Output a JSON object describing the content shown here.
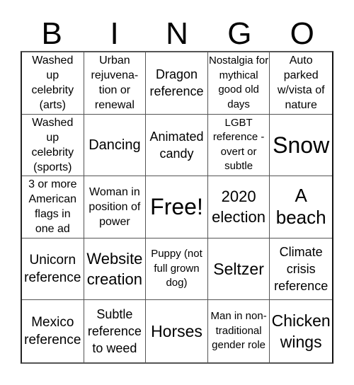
{
  "card": {
    "header": [
      "B",
      "I",
      "N",
      "G",
      "O"
    ],
    "rows": [
      [
        "Washed up celebrity (arts)",
        "Urban rejuvena- tion or renewal",
        "Dragon reference",
        "Nostalgia for mythical good old days",
        "Auto parked w/vista of nature"
      ],
      [
        "Washed up celebrity (sports)",
        "Dancing",
        "Animated candy",
        "LGBT reference - overt or subtle",
        "Snow"
      ],
      [
        "3 or more American flags in one ad",
        "Woman in position of power",
        "Free!",
        "2020 election",
        "A beach"
      ],
      [
        "Unicorn reference",
        "Website creation",
        "Puppy (not full grown dog)",
        "Seltzer",
        "Climate crisis reference"
      ],
      [
        "Mexico reference",
        "Subtle reference to weed",
        "Horses",
        "Man in non- traditional gender role",
        "Chicken wings"
      ]
    ],
    "free_space": "Free!"
  }
}
